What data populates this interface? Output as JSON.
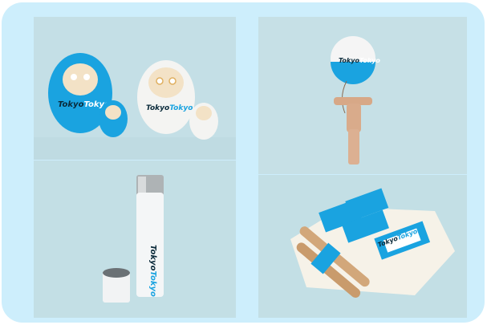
{
  "gallery": {
    "frame_color": "#cdeefc",
    "photos": [
      {
        "name": "daruma dolls",
        "brand_top": "Tokyo",
        "brand_bottom": "Tokyo"
      },
      {
        "name": "thermos bottle",
        "brand_top": "Tokyo",
        "brand_bottom": "Tokyo"
      },
      {
        "name": "kendama",
        "brand_top": "Tokyo",
        "brand_bottom": "Tokyo"
      },
      {
        "name": "snack packets",
        "brand_top": "Tokyo",
        "brand_bottom": "Tokyo"
      }
    ]
  }
}
